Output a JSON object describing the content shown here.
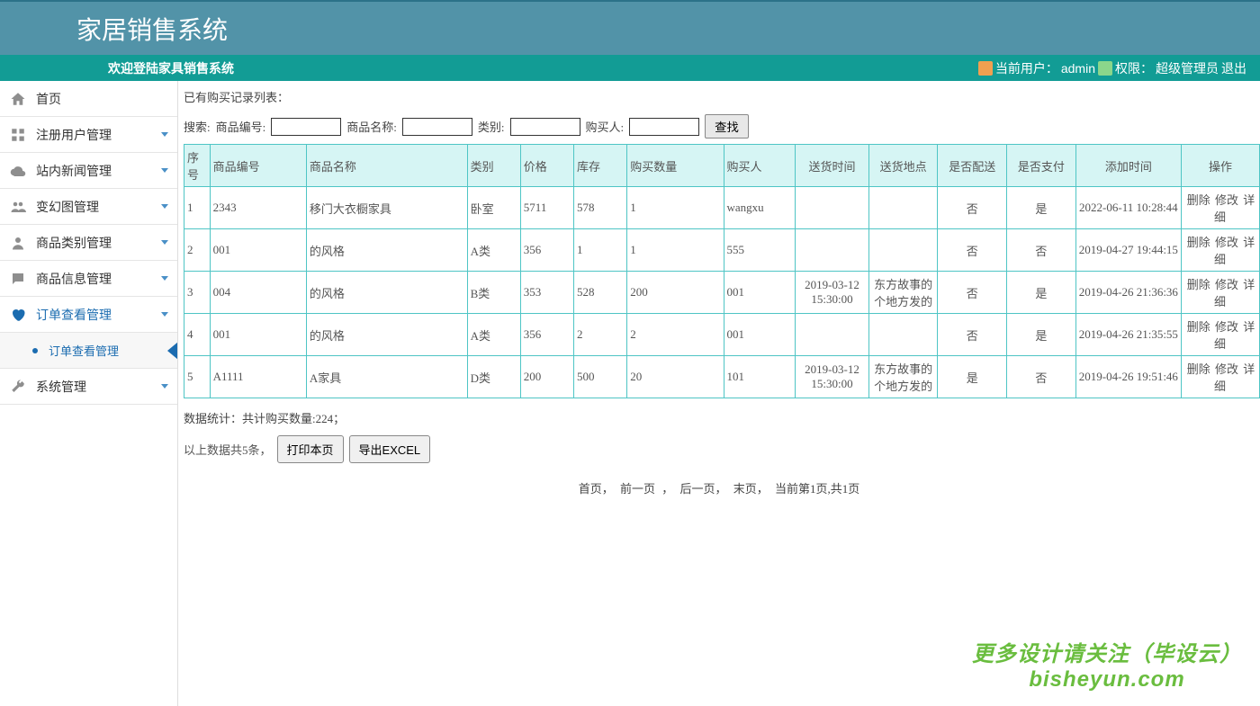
{
  "header": {
    "title": "家居销售系统"
  },
  "subheader": {
    "welcome": "欢迎登陆家具销售系统",
    "current_user_label": "当前用户：",
    "username": "admin",
    "permission_label": "权限：",
    "role": "超级管理员",
    "logout": "退出"
  },
  "sidebar": {
    "items": [
      {
        "label": "首页",
        "icon": "home",
        "has_arrow": false
      },
      {
        "label": "注册用户管理",
        "icon": "grid",
        "has_arrow": true
      },
      {
        "label": "站内新闻管理",
        "icon": "cloud",
        "has_arrow": true
      },
      {
        "label": "变幻图管理",
        "icon": "people",
        "has_arrow": true
      },
      {
        "label": "商品类别管理",
        "icon": "person",
        "has_arrow": true
      },
      {
        "label": "商品信息管理",
        "icon": "chat",
        "has_arrow": true
      },
      {
        "label": "订单查看管理",
        "icon": "heart",
        "has_arrow": true,
        "active": true
      },
      {
        "label": "系统管理",
        "icon": "wrench",
        "has_arrow": true
      }
    ],
    "submenu_label": "订单查看管理"
  },
  "content": {
    "list_title": "已有购买记录列表：",
    "search": {
      "prefix": "搜索:",
      "product_code_label": "商品编号:",
      "product_name_label": "商品名称:",
      "category_label": "类别:",
      "buyer_label": "购买人:",
      "button": "查找"
    },
    "table": {
      "headers": [
        "序号",
        "商品编号",
        "商品名称",
        "类别",
        "价格",
        "库存",
        "购买数量",
        "购买人",
        "送货时间",
        "送货地点",
        "是否配送",
        "是否支付",
        "添加时间",
        "操作"
      ],
      "rows": [
        {
          "idx": "1",
          "code": "2343",
          "name": "移门大衣橱家具",
          "cat": "卧室",
          "price": "5711",
          "stock": "578",
          "qty": "1",
          "buyer": "wangxu",
          "dtime": "",
          "dloc": "",
          "deliver": "否",
          "pay": "是",
          "atime": "2022-06-11 10:28:44"
        },
        {
          "idx": "2",
          "code": "001",
          "name": "的风格",
          "cat": "A类",
          "price": "356",
          "stock": "1",
          "qty": "1",
          "buyer": "555",
          "dtime": "",
          "dloc": "",
          "deliver": "否",
          "pay": "否",
          "atime": "2019-04-27 19:44:15"
        },
        {
          "idx": "3",
          "code": "004",
          "name": "的风格",
          "cat": "B类",
          "price": "353",
          "stock": "528",
          "qty": "200",
          "buyer": "001",
          "dtime": "2019-03-12 15:30:00",
          "dloc": "东方故事的个地方发的",
          "deliver": "否",
          "pay": "是",
          "atime": "2019-04-26 21:36:36"
        },
        {
          "idx": "4",
          "code": "001",
          "name": "的风格",
          "cat": "A类",
          "price": "356",
          "stock": "2",
          "qty": "2",
          "buyer": "001",
          "dtime": "",
          "dloc": "",
          "deliver": "否",
          "pay": "是",
          "atime": "2019-04-26 21:35:55"
        },
        {
          "idx": "5",
          "code": "A1111",
          "name": "A家具",
          "cat": "D类",
          "price": "200",
          "stock": "500",
          "qty": "20",
          "buyer": "101",
          "dtime": "2019-03-12 15:30:00",
          "dloc": "东方故事的个地方发的",
          "deliver": "是",
          "pay": "否",
          "atime": "2019-04-26 19:51:46"
        }
      ],
      "op_delete": "删除",
      "op_edit": "修改",
      "op_detail": "详细"
    },
    "stats": "数据统计：共计购买数量:224；",
    "records_prefix": "以上数据共5条，",
    "print_btn": "打印本页",
    "export_btn": "导出EXCEL",
    "pagination": {
      "first": "首页，",
      "prev": "前一页",
      "sep": "，",
      "next": "后一页，",
      "last": "末页，",
      "info": "当前第1页,共1页"
    }
  },
  "watermark": {
    "line1": "更多设计请关注（毕设云）",
    "line2": "bisheyun.com"
  }
}
